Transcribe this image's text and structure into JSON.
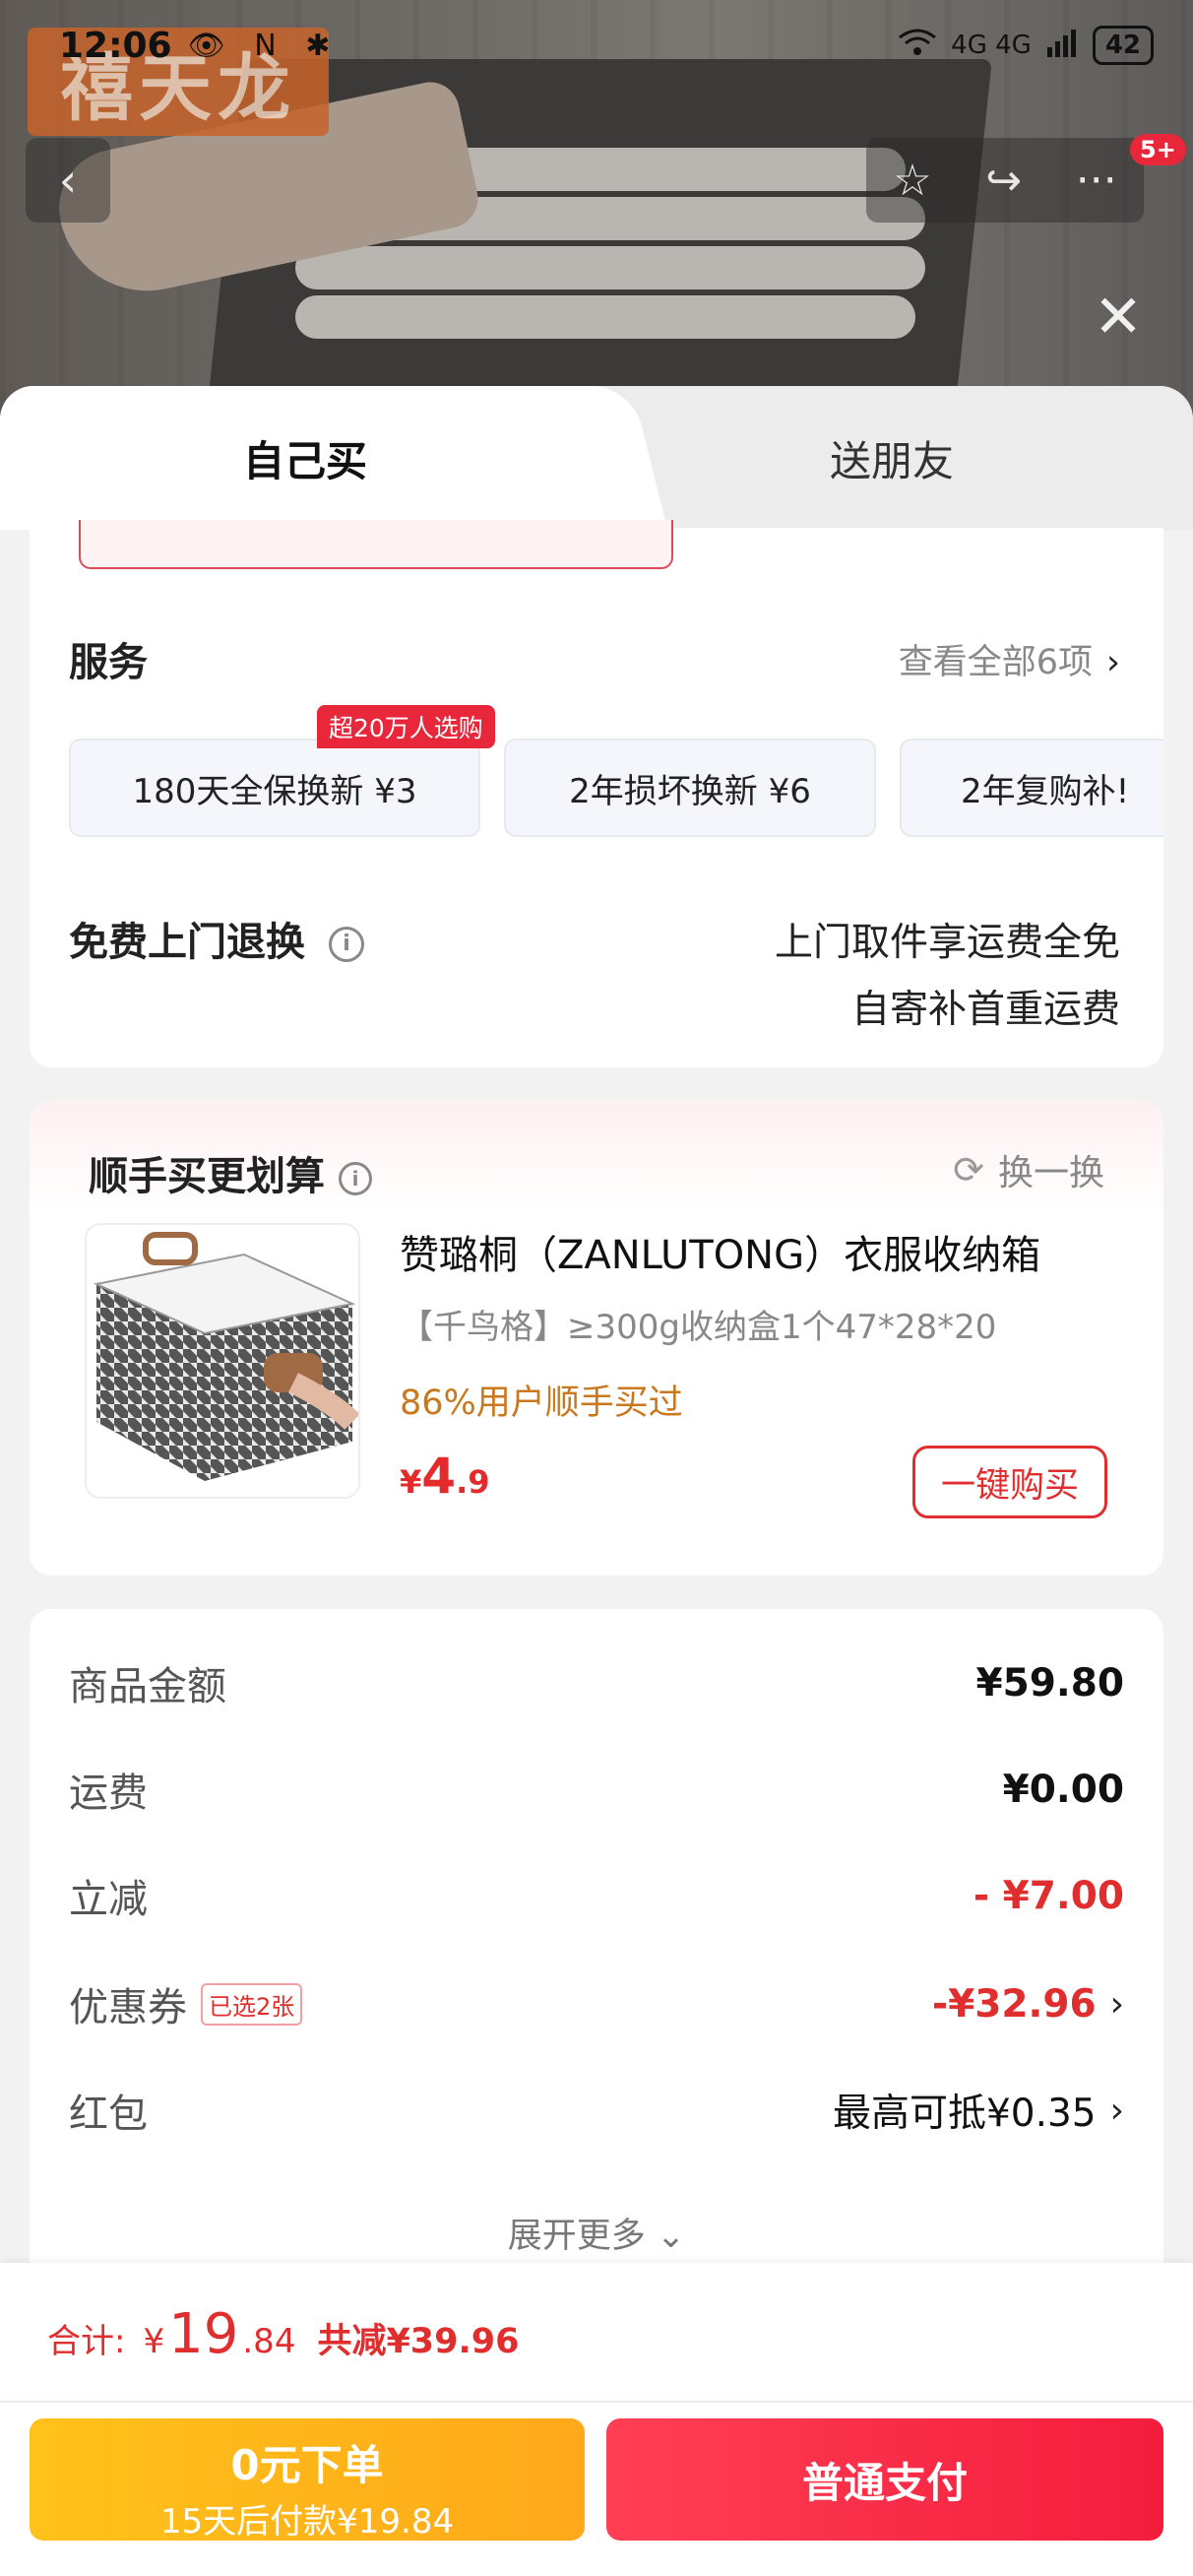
{
  "status_bar": {
    "time": "12:06",
    "left_icons": "👁 N ✱",
    "network": "4G  4G",
    "battery": "42"
  },
  "top_nav": {
    "back_icon": "‹",
    "star_icon": "☆",
    "share_icon": "↪",
    "more_icon": "···",
    "badge": "5+",
    "close_icon": "✕"
  },
  "backdrop": {
    "logo_text": "禧天龙"
  },
  "tabs": {
    "self": "自己买",
    "friend": "送朋友"
  },
  "service": {
    "title": "服务",
    "view_all": "查看全部6项",
    "hot_tag": "超20万人选购",
    "options": [
      {
        "label": "180天全保换新  ¥3"
      },
      {
        "label": "2年损坏换新  ¥6"
      },
      {
        "label": "2年复购补!"
      }
    ],
    "return_title": "免费上门退换",
    "return_line1": "上门取件享运费全免",
    "return_line2": "自寄补首重运费"
  },
  "upsell": {
    "title": "顺手买更划算",
    "swap": "换一换",
    "name": "赞璐桐（ZANLUTONG）衣服收纳箱",
    "spec": "【千鸟格】≥300g收纳盒1个47*28*20",
    "rate": "86%用户顺手买过",
    "price_currency": "¥",
    "price_int": "4",
    "price_dec": ".9",
    "buy": "一键购买"
  },
  "summary": {
    "rows": [
      {
        "label": "商品金额",
        "value": "¥59.80"
      },
      {
        "label": "运费",
        "value": "¥0.00"
      },
      {
        "label": "立减",
        "value": "- ¥7.00"
      },
      {
        "label": "优惠券",
        "value": "-¥32.96",
        "tag": "已选2张"
      },
      {
        "label": "红包",
        "value": "最高可抵¥0.35"
      }
    ],
    "more": "展开更多 ⌄"
  },
  "bottom": {
    "total_label": "合计:",
    "total_currency": "¥",
    "total_int": "19",
    "total_dec": ".84",
    "total_saved": "共减¥39.96",
    "later_line1": "0元下单",
    "later_line2": "15天后付款¥19.84",
    "pay": "普通支付"
  },
  "colors": {
    "accent_red": "#e02d2d",
    "yellow_button": "#ffb31a",
    "red_button": "#f72c44"
  }
}
